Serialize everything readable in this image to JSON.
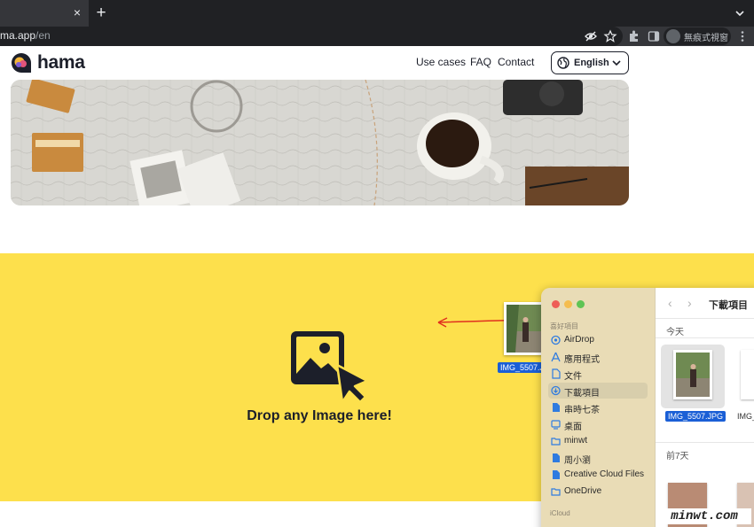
{
  "browser": {
    "url_host": "ma.app",
    "url_path": "/en",
    "incognito_label": "無痕式視窗",
    "new_tab_glyph": "+",
    "close_tab_glyph": "×"
  },
  "site": {
    "logo_text": "hama",
    "nav": {
      "use_cases": "Use cases",
      "faq": "FAQ",
      "contact": "Contact"
    },
    "language": "English"
  },
  "dropzone": {
    "text": "Drop any Image here!",
    "color": "#fde04c"
  },
  "drag": {
    "file_name": "IMG_5507.JPG"
  },
  "finder": {
    "title": "下載項目",
    "favorites_header": "喜好項目",
    "icloud_header": "iCloud",
    "sidebar": [
      {
        "label": "AirDrop",
        "icon": "airdrop-icon",
        "selected": false
      },
      {
        "label": "應用程式",
        "icon": "applications-icon",
        "selected": false
      },
      {
        "label": "文件",
        "icon": "document-icon",
        "selected": false
      },
      {
        "label": "下載項目",
        "icon": "download-icon",
        "selected": true
      },
      {
        "label": "串時七茶",
        "icon": "file-icon",
        "selected": false
      },
      {
        "label": "桌面",
        "icon": "desktop-icon",
        "selected": false
      },
      {
        "label": "minwt",
        "icon": "folder-icon",
        "selected": false
      },
      {
        "label": "周小瀏",
        "icon": "file-icon",
        "selected": false
      },
      {
        "label": "Creative Cloud Files",
        "icon": "file-icon",
        "selected": false
      },
      {
        "label": "OneDrive",
        "icon": "folder-icon",
        "selected": false
      }
    ],
    "today_label": "今天",
    "last7_label": "前7天",
    "files_today": [
      {
        "name": "IMG_5507.JPG",
        "selected": true
      },
      {
        "name": "IMG_",
        "selected": false
      }
    ]
  },
  "watermark": "minwt.com"
}
